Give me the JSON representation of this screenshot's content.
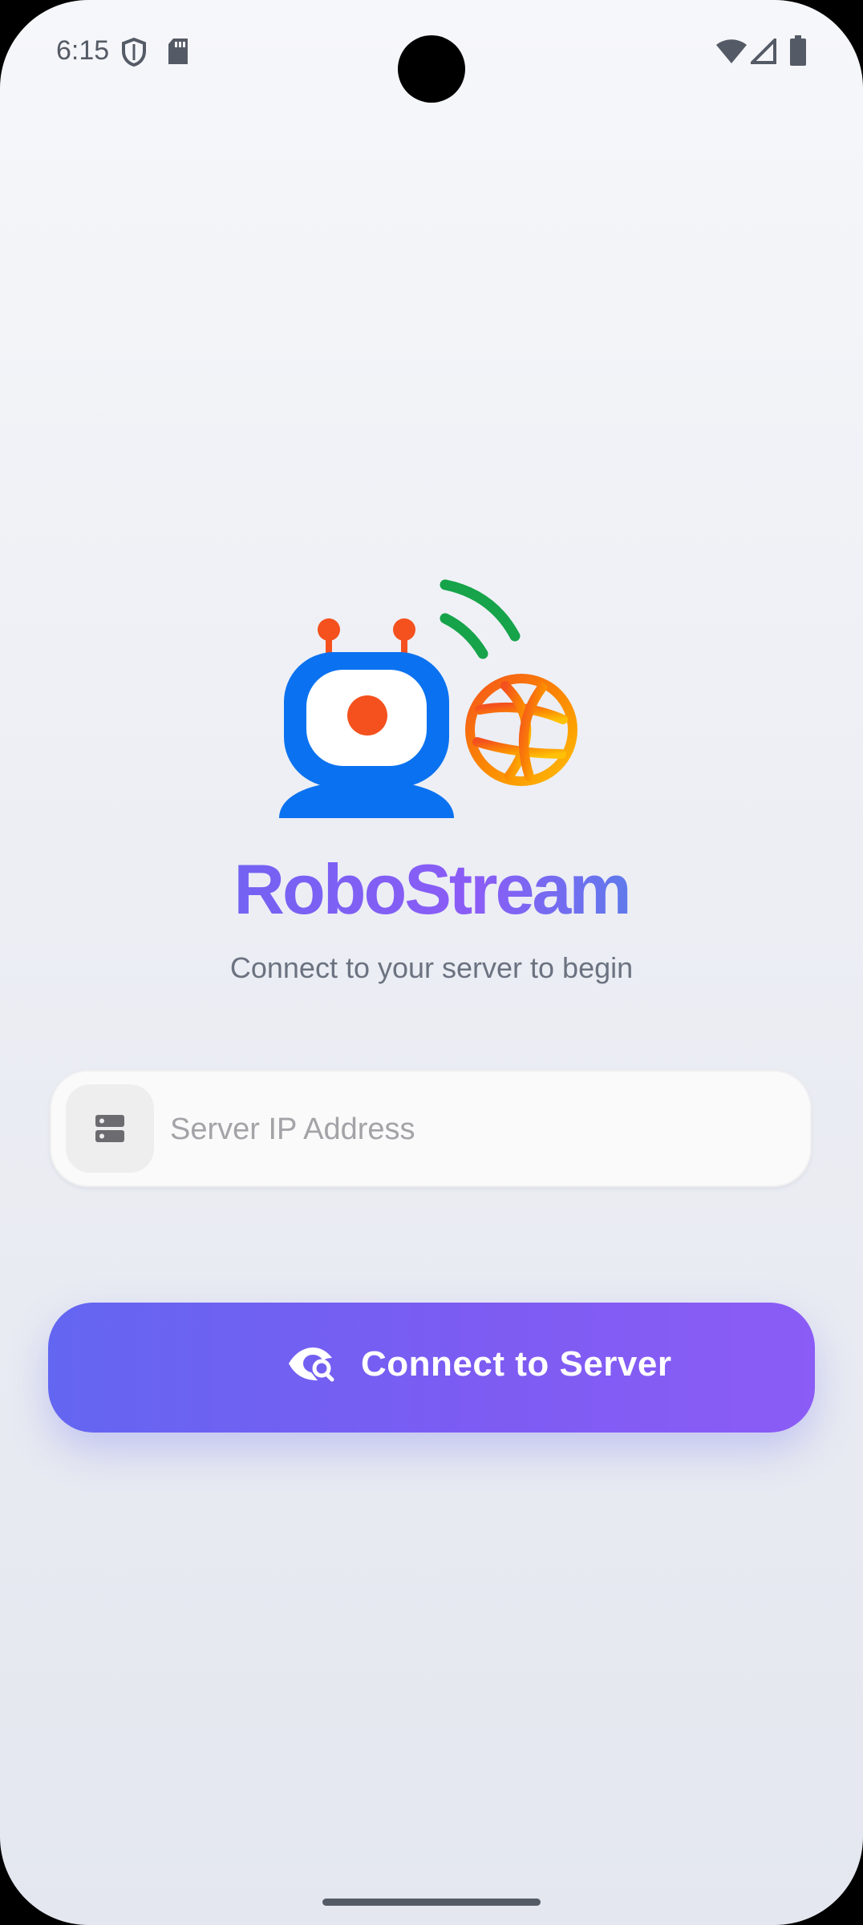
{
  "status_bar": {
    "time": "6:15",
    "icons": [
      "shield-icon",
      "sd-card-icon",
      "wifi-icon",
      "signal-icon",
      "battery-icon"
    ]
  },
  "app": {
    "title": "RoboStream",
    "subtitle": "Connect to your server to begin"
  },
  "server_input": {
    "placeholder": "Server IP Address",
    "value": "",
    "icon": "server-icon"
  },
  "connect_button": {
    "label": "Connect to Server",
    "icon": "eye-search-icon"
  },
  "colors": {
    "accent_start": "#6366f1",
    "accent_end": "#8b5cf6",
    "robot_blue": "#0a72f0",
    "signal_green": "#16a34a",
    "globe_orange": "#f97316"
  }
}
